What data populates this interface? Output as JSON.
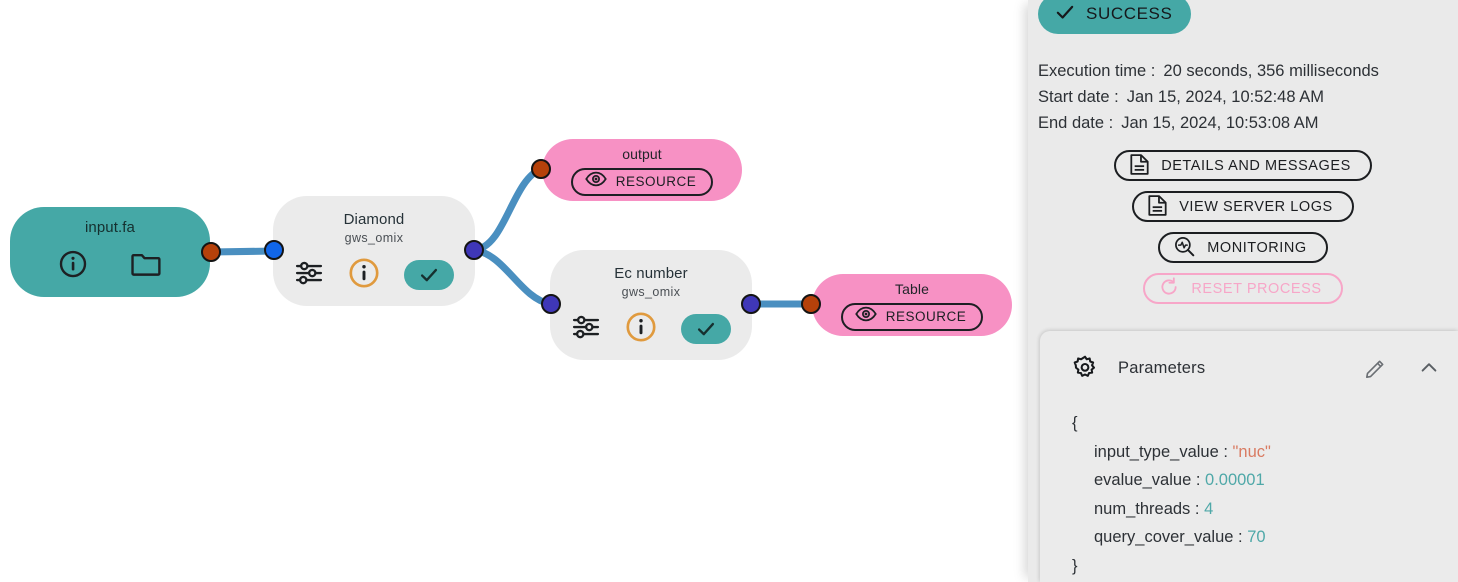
{
  "workflow": {
    "nodes": [
      {
        "id": "input-fa",
        "kind": "source",
        "title": "input.fa",
        "subtitle": "",
        "icons": [
          "info-icon",
          "folder-icon"
        ]
      },
      {
        "id": "diamond",
        "kind": "process",
        "title": "Diamond",
        "subtitle": "gws_omix",
        "icons": [
          "settings-sliders-icon",
          "info-icon",
          "check-icon"
        ]
      },
      {
        "id": "ec-number",
        "kind": "process",
        "title": "Ec number",
        "subtitle": "gws_omix",
        "icons": [
          "settings-sliders-icon",
          "info-icon",
          "check-icon"
        ]
      },
      {
        "id": "output",
        "kind": "resource",
        "title": "output",
        "badge": "RESOURCE",
        "icons": [
          "eye-icon"
        ]
      },
      {
        "id": "table",
        "kind": "resource",
        "title": "Table",
        "badge": "RESOURCE",
        "icons": [
          "eye-icon"
        ]
      }
    ],
    "colors": {
      "source_node": "#45a8a6",
      "process_node": "#ebebeb",
      "resource_node": "#f791c4",
      "edge": "#4a8fc0",
      "port_output": "#b5410a",
      "port_input_blue": "#1166e8",
      "port_indigo": "#3f37b8"
    }
  },
  "panel": {
    "status": {
      "label": "SUCCESS",
      "icon": "check-icon",
      "color": "#45a8a6"
    },
    "meta": [
      {
        "key": "Execution time :",
        "value": "20 seconds, 356 milliseconds"
      },
      {
        "key": "Start date :",
        "value": "Jan 15, 2024, 10:52:48 AM"
      },
      {
        "key": "End date :",
        "value": "Jan 15, 2024, 10:53:08 AM"
      }
    ],
    "buttons": [
      {
        "label": "DETAILS AND MESSAGES",
        "icon": "document-lines-icon",
        "disabled": false
      },
      {
        "label": "VIEW SERVER LOGS",
        "icon": "document-lines-icon",
        "disabled": false
      },
      {
        "label": "MONITORING",
        "icon": "magnifier-pulse-icon",
        "disabled": false
      },
      {
        "label": "RESET PROCESS",
        "icon": "refresh-icon",
        "disabled": true
      }
    ],
    "parameters": {
      "title": "Parameters",
      "icon": "gear-icon",
      "edit_icon": "pencil-icon",
      "collapse_icon": "chevron-up-icon",
      "open_brace": "{",
      "close_brace": "}",
      "entries": [
        {
          "key": "input_type_value :",
          "value": "\"nuc\"",
          "type": "string"
        },
        {
          "key": "evalue_value :",
          "value": "0.00001",
          "type": "number"
        },
        {
          "key": "num_threads :",
          "value": "4",
          "type": "number"
        },
        {
          "key": "query_cover_value :",
          "value": "70",
          "type": "number"
        }
      ]
    }
  }
}
